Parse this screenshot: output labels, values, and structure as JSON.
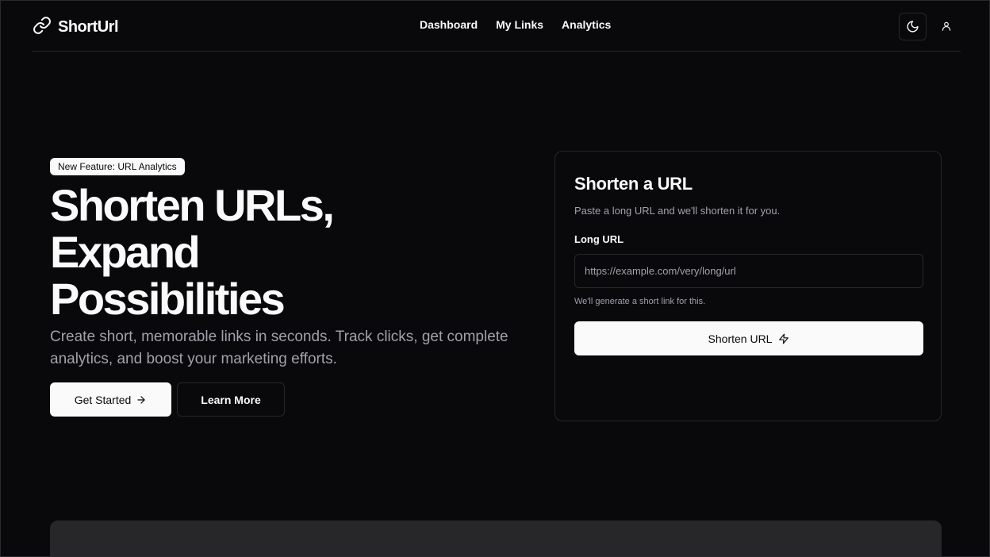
{
  "header": {
    "logo_text": "ShortUrl",
    "logo_icon": "link-icon",
    "nav": [
      {
        "label": "Dashboard"
      },
      {
        "label": "My Links"
      },
      {
        "label": "Analytics"
      }
    ],
    "theme_icon": "moon-icon",
    "user_icon": "user-icon"
  },
  "hero": {
    "badge": "New Feature: URL Analytics",
    "title_lines": [
      "Shorten URLs,",
      "Expand",
      "Possibilities"
    ],
    "description": "Create short, memorable links in seconds. Track clicks, get complete analytics, and boost your marketing efforts.",
    "primary_button": "Get Started",
    "secondary_button": "Learn More"
  },
  "card": {
    "title": "Shorten a URL",
    "description": "Paste a long URL and we'll shorten it for you.",
    "field_label": "Long URL",
    "input_placeholder": "https://example.com/very/long/url",
    "input_value": "",
    "hint": "We'll generate a short link for this.",
    "submit_label": "Shorten URL",
    "submit_icon": "zap-icon"
  },
  "colors": {
    "background": "#09090b",
    "foreground": "#fafafa",
    "muted": "#a1a1aa",
    "border": "#27272a"
  }
}
